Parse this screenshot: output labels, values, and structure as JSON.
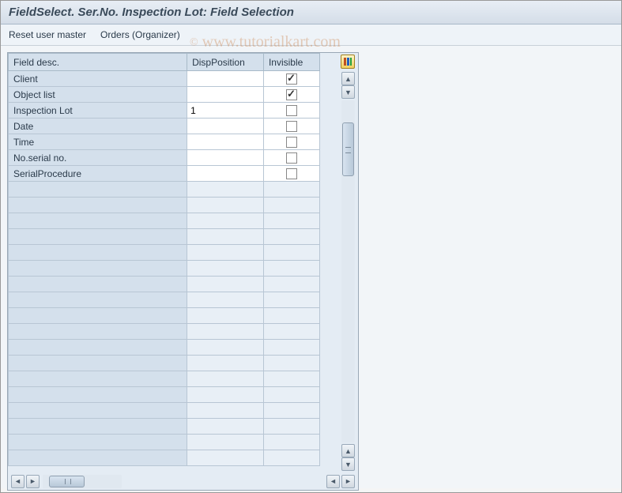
{
  "title": "FieldSelect. Ser.No. Inspection Lot: Field Selection",
  "toolbar": {
    "reset": "Reset user master",
    "orders": "Orders (Organizer)"
  },
  "columns": {
    "field_desc": "Field desc.",
    "disp_position": "DispPosition",
    "invisible": "Invisible"
  },
  "rows": [
    {
      "desc": "Client",
      "pos": "",
      "inv": true
    },
    {
      "desc": "Object list",
      "pos": "",
      "inv": true
    },
    {
      "desc": "Inspection Lot",
      "pos": "1",
      "inv": false
    },
    {
      "desc": "Date",
      "pos": "",
      "inv": false
    },
    {
      "desc": "Time",
      "pos": "",
      "inv": false
    },
    {
      "desc": "No.serial no.",
      "pos": "",
      "inv": false
    },
    {
      "desc": "SerialProcedure",
      "pos": "",
      "inv": false
    }
  ],
  "empty_rows": 18,
  "watermark": "www.tutorialkart.com"
}
